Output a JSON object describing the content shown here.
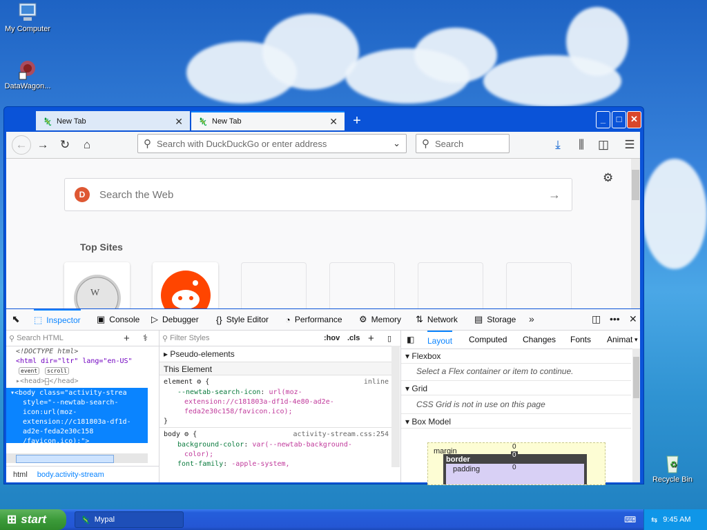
{
  "desktop": {
    "icons": [
      {
        "label": "My Computer",
        "icon": "my-computer-icon"
      },
      {
        "label": "DataWagon...",
        "icon": "datawagon-icon"
      },
      {
        "label": "Recycle Bin",
        "icon": "recycle-bin-icon"
      }
    ]
  },
  "browser": {
    "tabs": [
      {
        "label": "New Tab",
        "active": false
      },
      {
        "label": "New Tab",
        "active": true
      }
    ],
    "url_placeholder": "Search with DuckDuckGo or enter address",
    "search_placeholder": "Search",
    "page": {
      "websearch_placeholder": "Search the Web",
      "top_sites_title": "Top Sites"
    }
  },
  "devtools": {
    "tabs": [
      {
        "label": "Inspector",
        "icon": "inspector-icon"
      },
      {
        "label": "Console",
        "icon": "console-icon"
      },
      {
        "label": "Debugger",
        "icon": "debugger-icon"
      },
      {
        "label": "Style Editor",
        "icon": "style-editor-icon"
      },
      {
        "label": "Performance",
        "icon": "performance-icon"
      },
      {
        "label": "Memory",
        "icon": "memory-icon"
      },
      {
        "label": "Network",
        "icon": "network-icon"
      },
      {
        "label": "Storage",
        "icon": "storage-icon"
      }
    ],
    "inspector": {
      "search_placeholder": "Search HTML",
      "lines": [
        "<!DOCTYPE html>",
        "<html dir=\"ltr\" lang=\"en-US\"",
        "event",
        "scroll",
        "<head>",
        "</head>",
        "<body class=\"activity-strea",
        "style=\"--newtab-search-",
        "icon:url(moz-",
        "extension://c181803a-df1d-",
        "ad2e-feda2e30c158",
        "/favicon.ico);\">"
      ],
      "breadcrumb": [
        "html",
        "body.activity-stream"
      ]
    },
    "rules": {
      "filter_placeholder": "Filter Styles",
      "hov": ":hov",
      "cls": ".cls",
      "pseudo": "Pseudo-elements",
      "this_element": "This Element",
      "element_selector": "element",
      "element_source": "inline",
      "element_prop": "--newtab-search-icon",
      "element_val": [
        "url(moz-",
        "extension://c181803a-df1d-4e80-ad2e-",
        "feda2e30c158/favicon.ico);"
      ],
      "body_selector": "body",
      "body_source": "activity-stream.css:254",
      "bg_prop": "background-color",
      "bg_val": [
        "var(--newtab-background-",
        "color);"
      ],
      "font_prop": "font-family",
      "font_val": "-apple-system,"
    },
    "layout": {
      "tabs": [
        "Layout",
        "Computed",
        "Changes",
        "Fonts",
        "Animat"
      ],
      "flexbox_title": "Flexbox",
      "flexbox_text": "Select a Flex container or item to continue.",
      "grid_title": "Grid",
      "grid_text": "CSS Grid is not in use on this page",
      "boxmodel_title": "Box Model",
      "margin_label": "margin",
      "margin_value": "0",
      "border_label": "border",
      "border_value": "0",
      "padding_label": "padding",
      "padding_value": "0"
    }
  },
  "taskbar": {
    "start_label": "start",
    "task_label": "Mypal",
    "clock": "9:45 AM"
  }
}
